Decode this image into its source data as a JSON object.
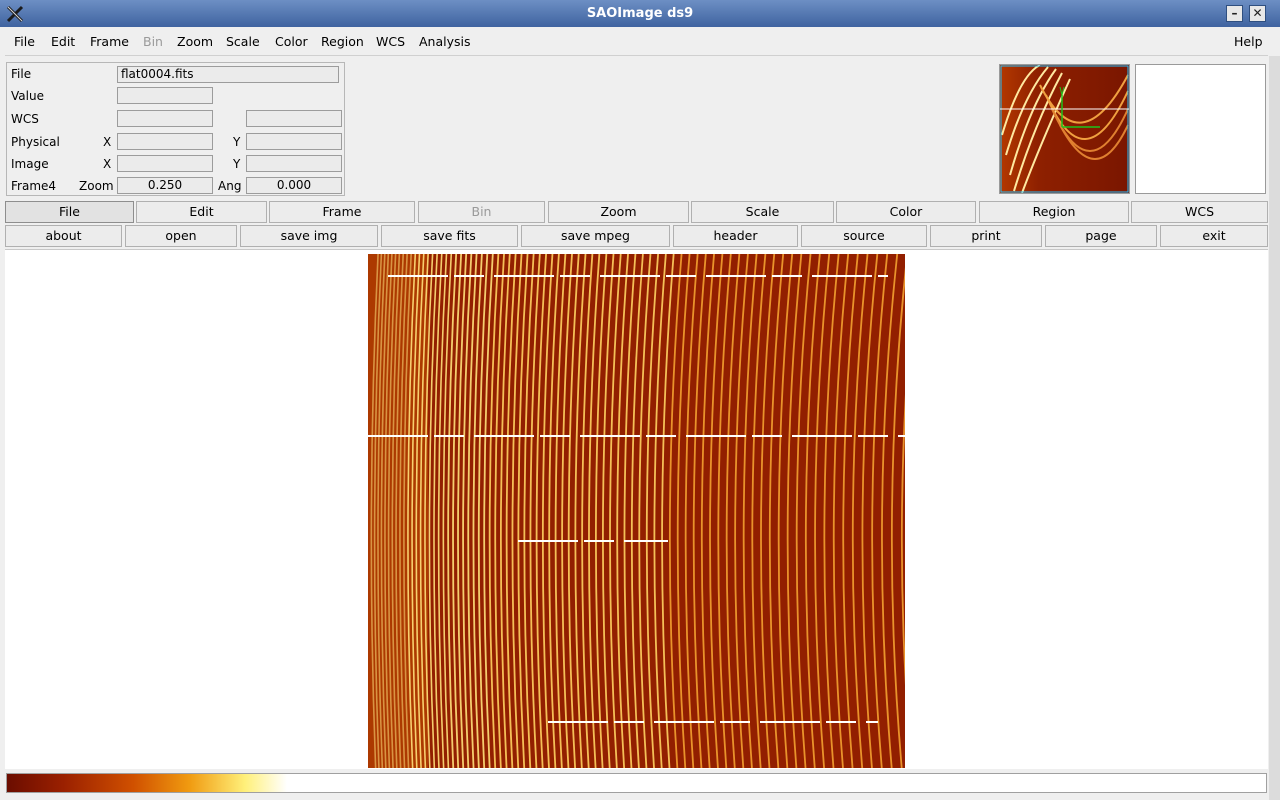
{
  "window": {
    "title": "SAOImage ds9"
  },
  "menu": {
    "file": "File",
    "edit": "Edit",
    "frame": "Frame",
    "bin": "Bin",
    "zoom": "Zoom",
    "scale": "Scale",
    "color": "Color",
    "region": "Region",
    "wcs": "WCS",
    "analysis": "Analysis",
    "help": "Help"
  },
  "info": {
    "file_label": "File",
    "file_value": "flat0004.fits",
    "value_label": "Value",
    "wcs_label": "WCS",
    "physical_label": "Physical",
    "x_label": "X",
    "y_label": "Y",
    "image_label": "Image",
    "frame_label": "Frame4",
    "zoom_label": "Zoom",
    "zoom_value": "0.250",
    "ang_label": "Ang",
    "ang_value": "0.000"
  },
  "buttonbar": {
    "major": [
      "File",
      "Edit",
      "Frame",
      "Bin",
      "Zoom",
      "Scale",
      "Color",
      "Region",
      "WCS"
    ],
    "minor": [
      "about",
      "open",
      "save img",
      "save fits",
      "save mpeg",
      "header",
      "source",
      "print",
      "page",
      "exit"
    ]
  },
  "colors": {
    "image_base": "#8f1f00",
    "fringe": "#ffe28a",
    "titlebar": "#4a6fa5"
  },
  "icons": {
    "app": "x-logo-icon",
    "minimize": "minimize-icon",
    "close": "close-icon"
  }
}
